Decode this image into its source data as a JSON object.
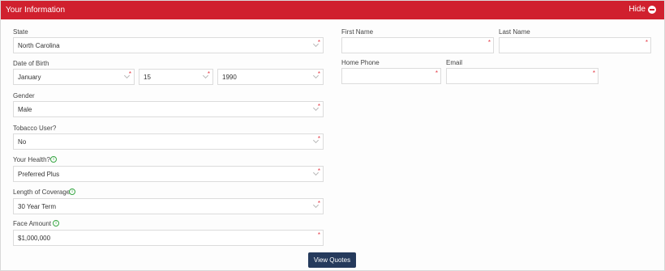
{
  "header": {
    "title": "Your Information",
    "hide_label": "Hide"
  },
  "form": {
    "state": {
      "label": "State",
      "value": "North Carolina"
    },
    "dob": {
      "label": "Date of Birth",
      "month": "January",
      "day": "15",
      "year": "1990"
    },
    "gender": {
      "label": "Gender",
      "value": "Male"
    },
    "tobacco": {
      "label": "Tobacco User?",
      "value": "No"
    },
    "health": {
      "label": "Your Health?",
      "value": "Preferred Plus"
    },
    "coverage": {
      "label": "Length of Coverage",
      "value": "30 Year Term"
    },
    "face_amount": {
      "label": "Face Amount",
      "value": "$1,000,000"
    },
    "first_name": {
      "label": "First Name",
      "value": ""
    },
    "last_name": {
      "label": "Last Name",
      "value": ""
    },
    "home_phone": {
      "label": "Home Phone",
      "value": ""
    },
    "email": {
      "label": "Email",
      "value": ""
    },
    "required_mark": "*"
  },
  "actions": {
    "view_quotes": "View Quotes"
  },
  "colors": {
    "header": "#d0202e",
    "button": "#253a5c",
    "required": "#e53945",
    "info": "#39a845"
  }
}
